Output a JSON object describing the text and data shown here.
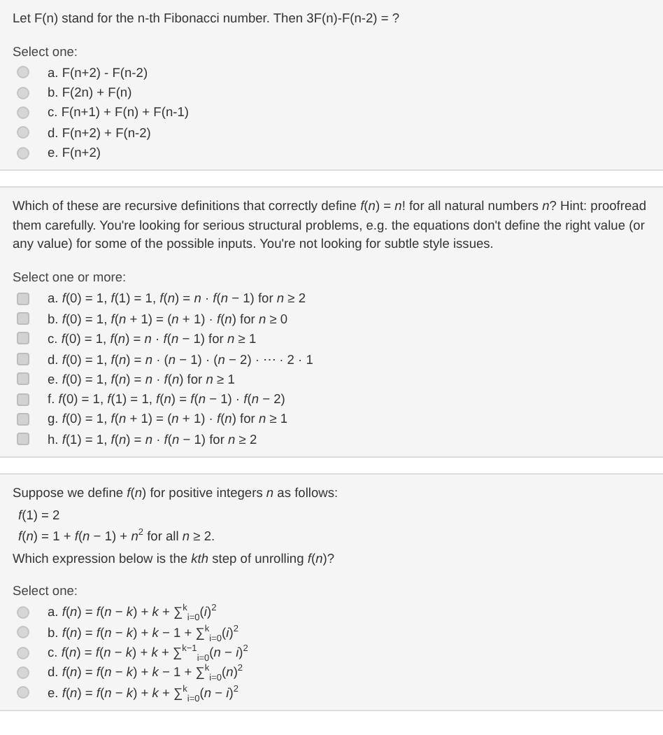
{
  "questions": [
    {
      "body": [
        {
          "kind": "text",
          "text": "Let F(n) stand for the n-th Fibonacci number. Then 3F(n)-F(n-2) = ?"
        }
      ],
      "prompt": "Select one:",
      "kind": "radio",
      "options": [
        {
          "label": "a. F(n+2) - F(n-2)",
          "selected": false
        },
        {
          "label": "b. F(2n) + F(n)",
          "selected": false
        },
        {
          "label": "c. F(n+1) + F(n) + F(n-1)",
          "selected": false
        },
        {
          "label": "d. F(n+2) + F(n-2)",
          "selected": false
        },
        {
          "label": "e. F(n+2)",
          "selected": false
        }
      ]
    },
    {
      "body": [
        {
          "kind": "text",
          "text": "Which of these are recursive definitions that correctly define *f*(*n*) = *n*! for all natural numbers *n*? Hint: proofread them carefully. You're looking for serious structural problems, e.g. the equations don't define the right value (or any value) for some of the possible inputs. You're not looking for subtle style issues."
        }
      ],
      "prompt": "Select one or more:",
      "kind": "checkbox",
      "options": [
        {
          "label": "a. *f*(0) = 1, *f*(1) = 1, *f*(*n*) = *n* · *f*(*n* − 1) for *n* ≥ 2",
          "checked": false
        },
        {
          "label": "b. *f*(0) = 1, *f*(*n* + 1) = (*n* + 1) · *f*(*n*) for *n* ≥ 0",
          "checked": false
        },
        {
          "label": "c. *f*(0) = 1, *f*(*n*) = *n* · *f*(*n* − 1) for *n* ≥ 1",
          "checked": false
        },
        {
          "label": "d. *f*(0) = 1, *f*(*n*) = *n* · (*n* − 1) · (*n* − 2) · ⋯ · 2 · 1",
          "checked": false
        },
        {
          "label": "e. *f*(0) = 1, *f*(*n*) = *n* · *f*(*n*) for *n* ≥ 1",
          "checked": false
        },
        {
          "label": "f. *f*(0) = 1, *f*(1) = 1, *f*(*n*) = *f*(*n* − 1) · *f*(*n* − 2)",
          "checked": false
        },
        {
          "label": "g. *f*(0) = 1, *f*(*n* + 1) = (*n* + 1) · *f*(*n*) for *n* ≥ 1",
          "checked": false
        },
        {
          "label": "h. *f*(1) = 1, *f*(*n*) = *n* · *f*(*n* − 1) for *n* ≥ 2",
          "checked": false
        }
      ]
    },
    {
      "body": [
        {
          "kind": "text",
          "text": "Suppose we define *f*(*n*) for positive integers *n* as follows:"
        },
        {
          "kind": "formula",
          "text": "*f*(1) = 2"
        },
        {
          "kind": "formula",
          "text": "*f*(*n*) = 1 + *f*(*n* − 1) + *n*$^{2}$   for all  *n* ≥ 2."
        },
        {
          "kind": "text",
          "text": "Which expression below is the *kth* step of unrolling *f*(*n*)?"
        }
      ],
      "prompt": "Select one:",
      "kind": "radio",
      "options": [
        {
          "label": "a. *f*(*n*) = *f*(*n* − *k*) + *k* + ∑$^{k}$$_{i=0}$(*i*)$^{2}$",
          "selected": false
        },
        {
          "label": "b. *f*(*n*) = *f*(*n* − *k*) + *k* − 1 + ∑$^{k}$$_{i=0}$(*i*)$^{2}$",
          "selected": false
        },
        {
          "label": "c. *f*(*n*) = *f*(*n* − *k*) + *k* + ∑$^{k−1}$$_{i=0}$(*n* − *i*)$^{2}$",
          "selected": false
        },
        {
          "label": "d. *f*(*n*) = *f*(*n* − *k*) + *k* − 1 + ∑$^{k}$$_{i=0}$(*n*)$^{2}$",
          "selected": false
        },
        {
          "label": "e. *f*(*n*) = *f*(*n* − *k*) + *k* + ∑$^{k}$$_{i=0}$(*n* − *i*)$^{2}$",
          "selected": false
        }
      ]
    }
  ]
}
